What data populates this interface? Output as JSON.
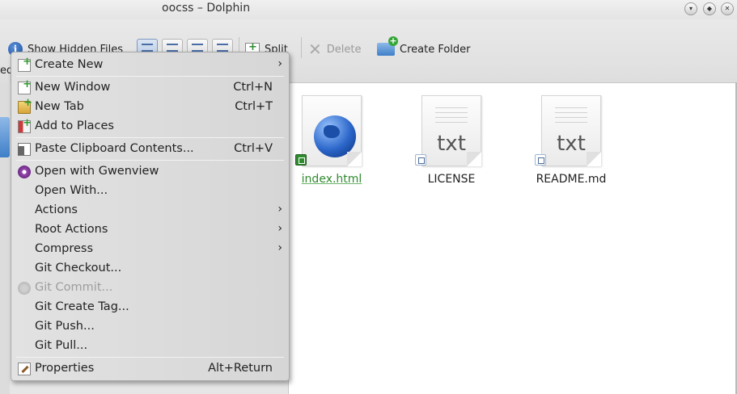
{
  "window": {
    "title": "oocss – Dolphin",
    "controls": [
      "minimize-icon",
      "maximize-icon",
      "close-icon"
    ]
  },
  "toolbar": {
    "show_hidden": "Show Hidden Files",
    "split": "Split",
    "delete": "Delete",
    "create_folder": "Create Folder",
    "partial_left": "ed"
  },
  "files": [
    {
      "name": "index.html",
      "icon": "html-globe-icon",
      "git": "versioned"
    },
    {
      "name": "LICENSE",
      "icon": "txt-file-icon",
      "mark": "txt",
      "git": "unversioned"
    },
    {
      "name": "README.md",
      "icon": "txt-file-icon",
      "mark": "txt",
      "git": "unversioned"
    }
  ],
  "menu": {
    "items": [
      {
        "label": "Create New",
        "shortcut": "",
        "submenu": true,
        "icon": "create-new-icon"
      },
      {
        "label": "New Window",
        "shortcut": "Ctrl+N",
        "icon": "new-window-icon"
      },
      {
        "label": "New Tab",
        "shortcut": "Ctrl+T",
        "icon": "new-tab-icon"
      },
      {
        "label": "Add to Places",
        "shortcut": "",
        "icon": "add-places-icon"
      },
      {
        "label": "Paste Clipboard Contents...",
        "shortcut": "Ctrl+V",
        "icon": "paste-icon"
      },
      {
        "label": "Open with Gwenview",
        "shortcut": "",
        "icon": "gwenview-icon"
      },
      {
        "label": "Open With...",
        "shortcut": ""
      },
      {
        "label": "Actions",
        "shortcut": "",
        "submenu": true
      },
      {
        "label": "Root Actions",
        "shortcut": "",
        "submenu": true
      },
      {
        "label": "Compress",
        "shortcut": "",
        "submenu": true
      },
      {
        "label": "Git Checkout...",
        "shortcut": ""
      },
      {
        "label": "Git Commit...",
        "shortcut": "",
        "disabled": true,
        "icon": "git-commit-icon"
      },
      {
        "label": "Git Create Tag...",
        "shortcut": ""
      },
      {
        "label": "Git Push...",
        "shortcut": ""
      },
      {
        "label": "Git Pull...",
        "shortcut": ""
      },
      {
        "label": "Properties",
        "shortcut": "Alt+Return",
        "icon": "properties-icon"
      }
    ],
    "submenu_arrow": "›"
  }
}
